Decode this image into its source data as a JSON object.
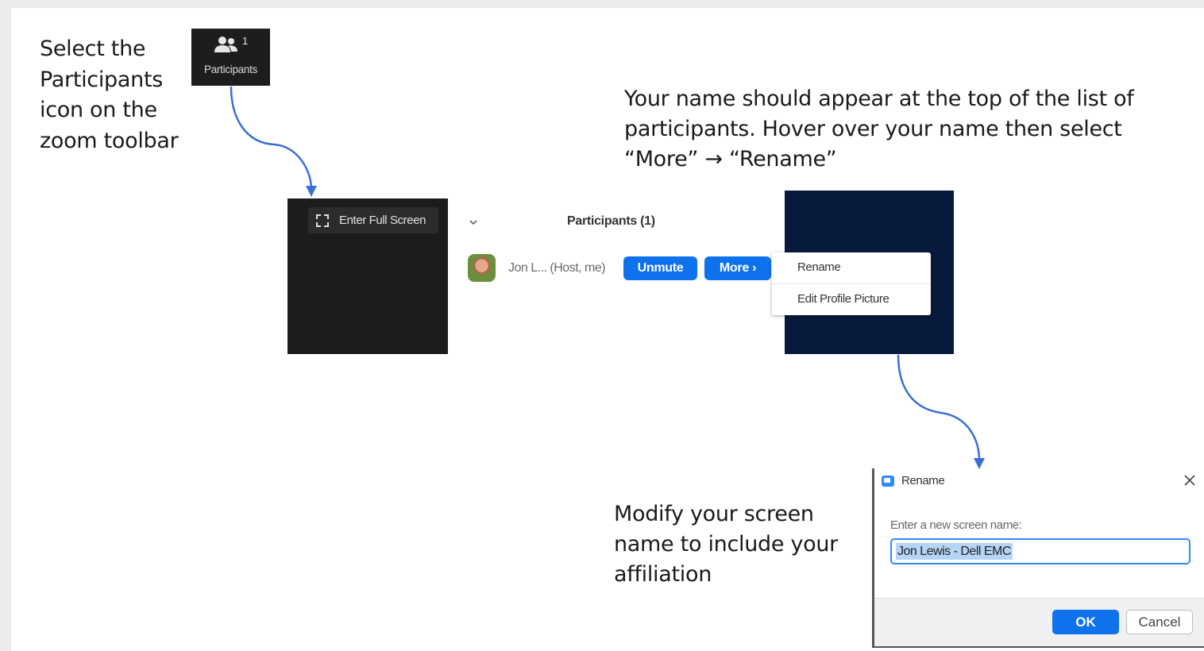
{
  "instructions": {
    "step1": "Select the Participants icon on the zoom toolbar",
    "step2": "Your name should appear at the top of the list of participants.  Hover over your name then select “More” → “Rename”",
    "step3": "Modify your screen name to include your affiliation"
  },
  "toolbar": {
    "participants_count": "1",
    "participants_label": "Participants",
    "icon": "participants-icon"
  },
  "video_panel": {
    "fullscreen_label": "Enter Full Screen",
    "icon": "fullscreen-icon"
  },
  "participants_panel": {
    "title": "Participants (1)",
    "participant_name": "Jon L... (Host, me)",
    "unmute_label": "Unmute",
    "more_label": "More ›"
  },
  "more_menu": {
    "items": [
      {
        "label": "Rename"
      },
      {
        "label": "Edit Profile Picture"
      }
    ]
  },
  "rename_dialog": {
    "title": "Rename",
    "prompt": "Enter a new screen name:",
    "input_value": "Jon Lewis - Dell EMC",
    "ok_label": "OK",
    "cancel_label": "Cancel"
  },
  "colors": {
    "zoom_blue": "#0e72ed",
    "arrow_blue": "#3b6fd6",
    "navy_backdrop": "#071a3b",
    "toolbar_dark": "#1d1d1d"
  }
}
